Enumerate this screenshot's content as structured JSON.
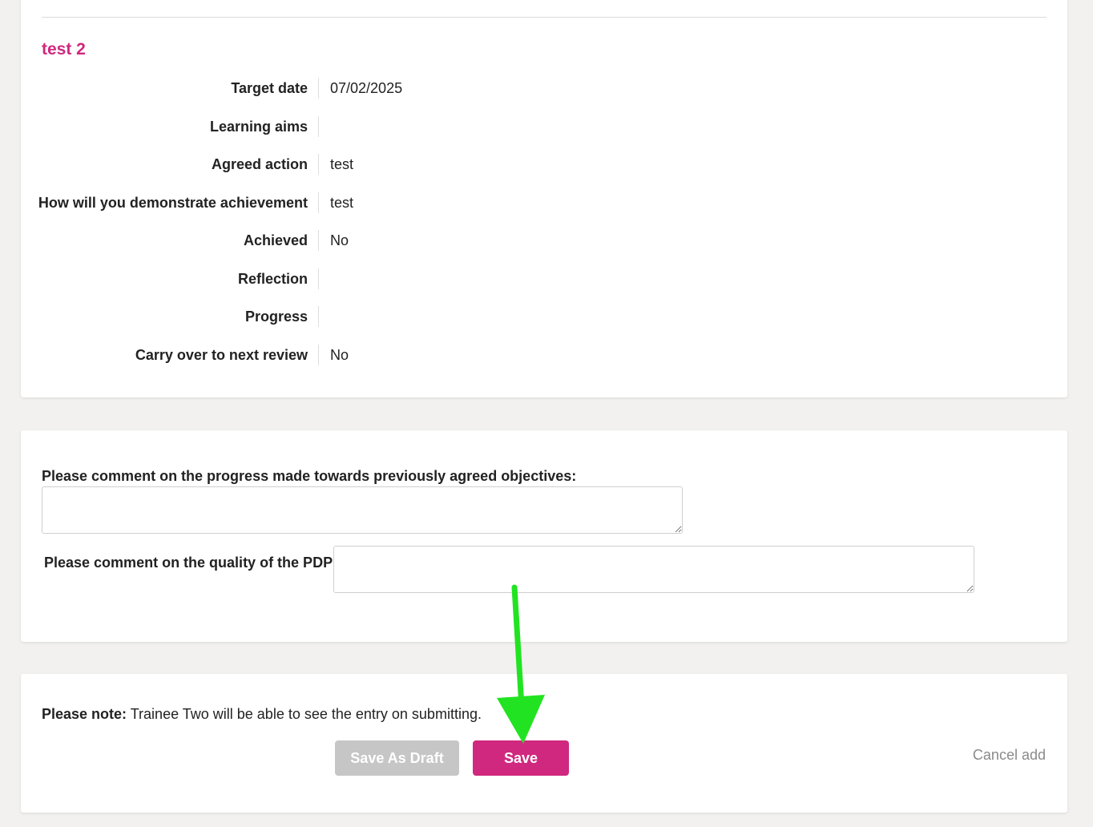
{
  "objective": {
    "title": "test 2",
    "details": [
      {
        "label": "Target date",
        "value": "07/02/2025"
      },
      {
        "label": "Learning aims",
        "value": ""
      },
      {
        "label": "Agreed action",
        "value": "test"
      },
      {
        "label": "How will you demonstrate achievement",
        "value": "test"
      },
      {
        "label": "Achieved",
        "value": "No"
      },
      {
        "label": "Reflection",
        "value": ""
      },
      {
        "label": "Progress",
        "value": ""
      },
      {
        "label": "Carry over to next review",
        "value": "No"
      }
    ]
  },
  "comments": {
    "progress_label": "Please comment on the progress made towards previously agreed objectives:",
    "progress_value": "",
    "pdp_label": "Please comment on the quality of the PDP:",
    "pdp_value": ""
  },
  "submit": {
    "note_bold": "Please note:",
    "note_text": " Trainee Two will be able to see the entry on submitting.",
    "draft_label": "Save As Draft",
    "save_label": "Save",
    "cancel_label": "Cancel add"
  },
  "colors": {
    "accent": "#d0287f",
    "draft_button": "#c6c6c6",
    "annotation_arrow": "#22e322"
  },
  "annotation": {
    "icon": "green-arrow-down-icon"
  }
}
